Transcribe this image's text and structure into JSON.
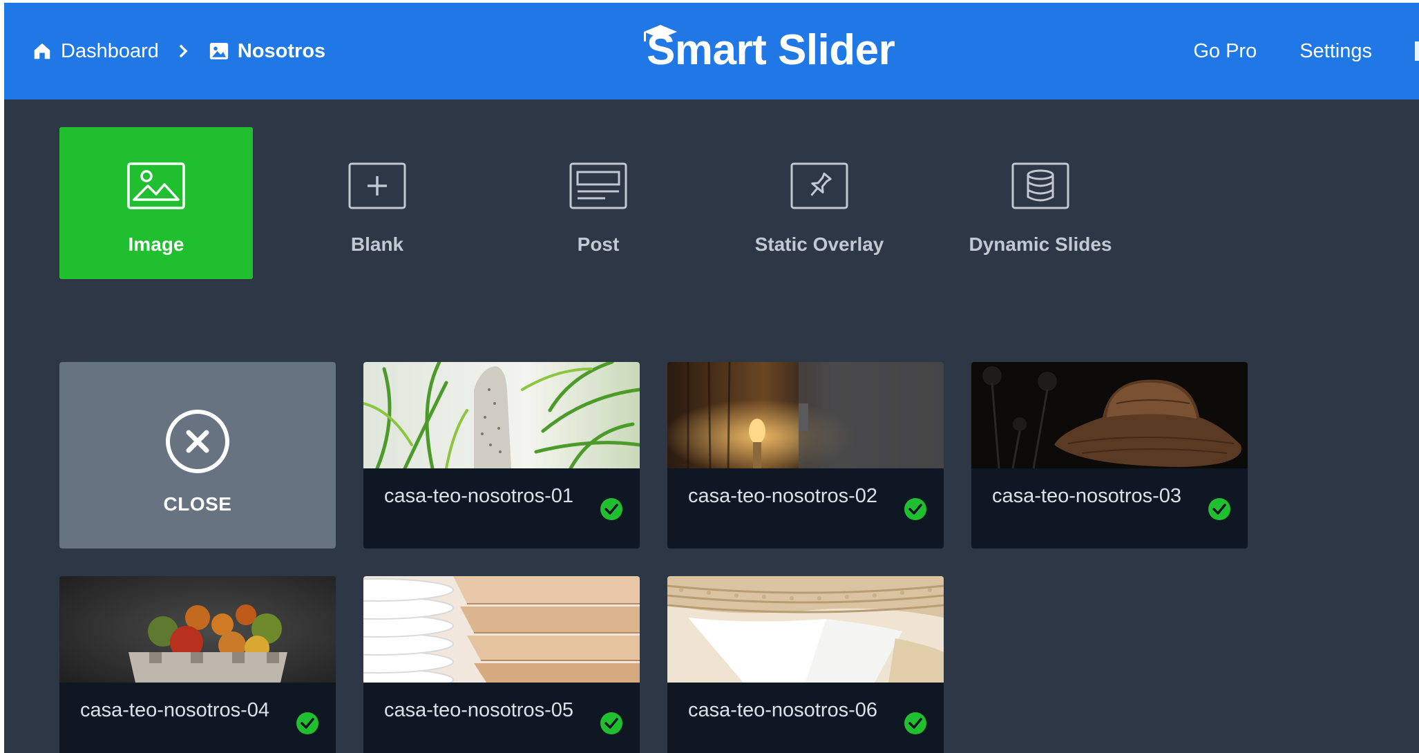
{
  "breadcrumb": {
    "home_label": "Dashboard",
    "current_label": "Nosotros"
  },
  "brand": {
    "name": "Smart Slider"
  },
  "nav": {
    "go_pro": "Go Pro",
    "settings": "Settings"
  },
  "slide_types": [
    {
      "label": "Image",
      "icon": "image-icon",
      "active": true
    },
    {
      "label": "Blank",
      "icon": "plus-box-icon",
      "active": false
    },
    {
      "label": "Post",
      "icon": "post-icon",
      "active": false
    },
    {
      "label": "Static Overlay",
      "icon": "pin-icon",
      "active": false
    },
    {
      "label": "Dynamic Slides",
      "icon": "database-icon",
      "active": false
    }
  ],
  "close_label": "CLOSE",
  "images": [
    {
      "name": "casa-teo-nosotros-01"
    },
    {
      "name": "casa-teo-nosotros-02"
    },
    {
      "name": "casa-teo-nosotros-03"
    },
    {
      "name": "casa-teo-nosotros-04"
    },
    {
      "name": "casa-teo-nosotros-05"
    },
    {
      "name": "casa-teo-nosotros-06"
    }
  ],
  "colors": {
    "header": "#1f78e5",
    "background": "#2d3745",
    "active_type": "#1fbf2f",
    "check": "#1fbf2f",
    "close_tile": "#677381"
  }
}
